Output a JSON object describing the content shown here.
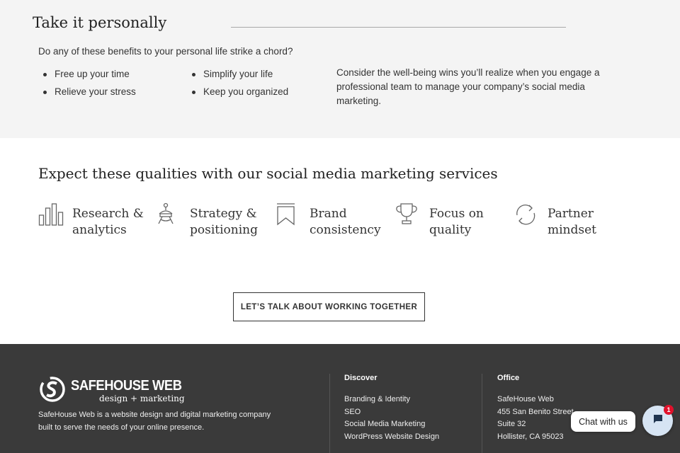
{
  "personal": {
    "title": "Take it personally",
    "question": "Do any of these benefits to your personal life strike a chord?",
    "benefits": [
      "Free up your time",
      "Simplify your life",
      "Relieve your stress",
      "Keep you organized"
    ],
    "note": "Consider the well-being wins you’ll realize when you engage a professional team to manage your company’s social media marketing."
  },
  "qualities": {
    "title": "Expect these qualities with our social media marketing services",
    "items": [
      {
        "label": "Research &\nanalytics",
        "icon": "bar-chart-icon"
      },
      {
        "label": "Strategy &\npositioning",
        "icon": "strategy-icon"
      },
      {
        "label": "Brand\nconsistency",
        "icon": "bookmark-icon"
      },
      {
        "label": "Focus on\nquality",
        "icon": "trophy-icon"
      },
      {
        "label": "Partner\nmindset",
        "icon": "refresh-icon"
      }
    ]
  },
  "cta": {
    "label": "LET’S TALK ABOUT WORKING TOGETHER"
  },
  "footer": {
    "logo_title": "SAFEHOUSE WEB",
    "logo_sub": "design + marketing",
    "description": "SafeHouse Web is a website design and digital marketing company built to serve the needs of your online presence.",
    "discover": {
      "title": "Discover",
      "links": [
        "Branding & Identity",
        "SEO",
        "Social Media Marketing",
        "WordPress Website Design"
      ]
    },
    "office": {
      "title": "Office",
      "lines": [
        "SafeHouse Web",
        "455 San Benito Street",
        "Suite 32",
        "Hollister, CA 95023"
      ]
    }
  },
  "chat": {
    "label": "Chat with us",
    "badge": "1",
    "icon": "chat-icon"
  },
  "colors": {
    "gray_band": "#f4f4f4",
    "footer_bg": "#3a3a3a",
    "badge_red": "#e0112b",
    "chat_bubble": "#d6e4f3"
  }
}
